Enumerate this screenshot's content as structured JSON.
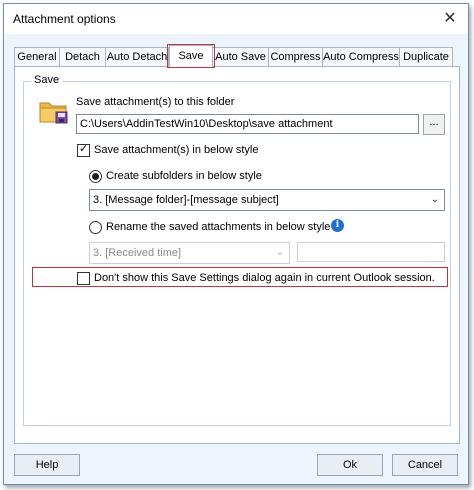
{
  "window": {
    "title": "Attachment options",
    "close_symbol": "✕"
  },
  "tabs": [
    {
      "label": "General"
    },
    {
      "label": "Detach"
    },
    {
      "label": "Auto Detach"
    },
    {
      "label": "Save",
      "active": true
    },
    {
      "label": "Auto Save"
    },
    {
      "label": "Compress"
    },
    {
      "label": "Auto Compress"
    },
    {
      "label": "Duplicate"
    }
  ],
  "save_group": {
    "title": "Save",
    "folder_icon": "folder-save-icon",
    "folder_label": "Save attachment(s) to this folder",
    "folder_path": "C:\\Users\\AddinTestWin10\\Desktop\\save attachment",
    "browse_label": "...",
    "save_in_style": {
      "label": "Save attachment(s) in below style",
      "checked": true
    },
    "create_subfolders": {
      "label": "Create subfolders in below style",
      "selected": true
    },
    "subfolder_style": {
      "value": "3. [Message folder]-[message subject]"
    },
    "rename_saved": {
      "label": "Rename the saved attachments in below style",
      "selected": false
    },
    "info_icon": "info-icon",
    "info_symbol": "i",
    "rename_style": {
      "value": "3. [Received time]",
      "disabled": true
    },
    "rename_extra": {
      "value": ""
    },
    "dont_show": {
      "label": "Don't show this Save Settings dialog again in current Outlook session.",
      "checked": false
    }
  },
  "buttons": {
    "help": "Help",
    "ok": "Ok",
    "cancel": "Cancel"
  },
  "colors": {
    "highlight_border": "#c0343e",
    "info_blue": "#1d6fd1",
    "window_bg": "#eef4fc"
  }
}
